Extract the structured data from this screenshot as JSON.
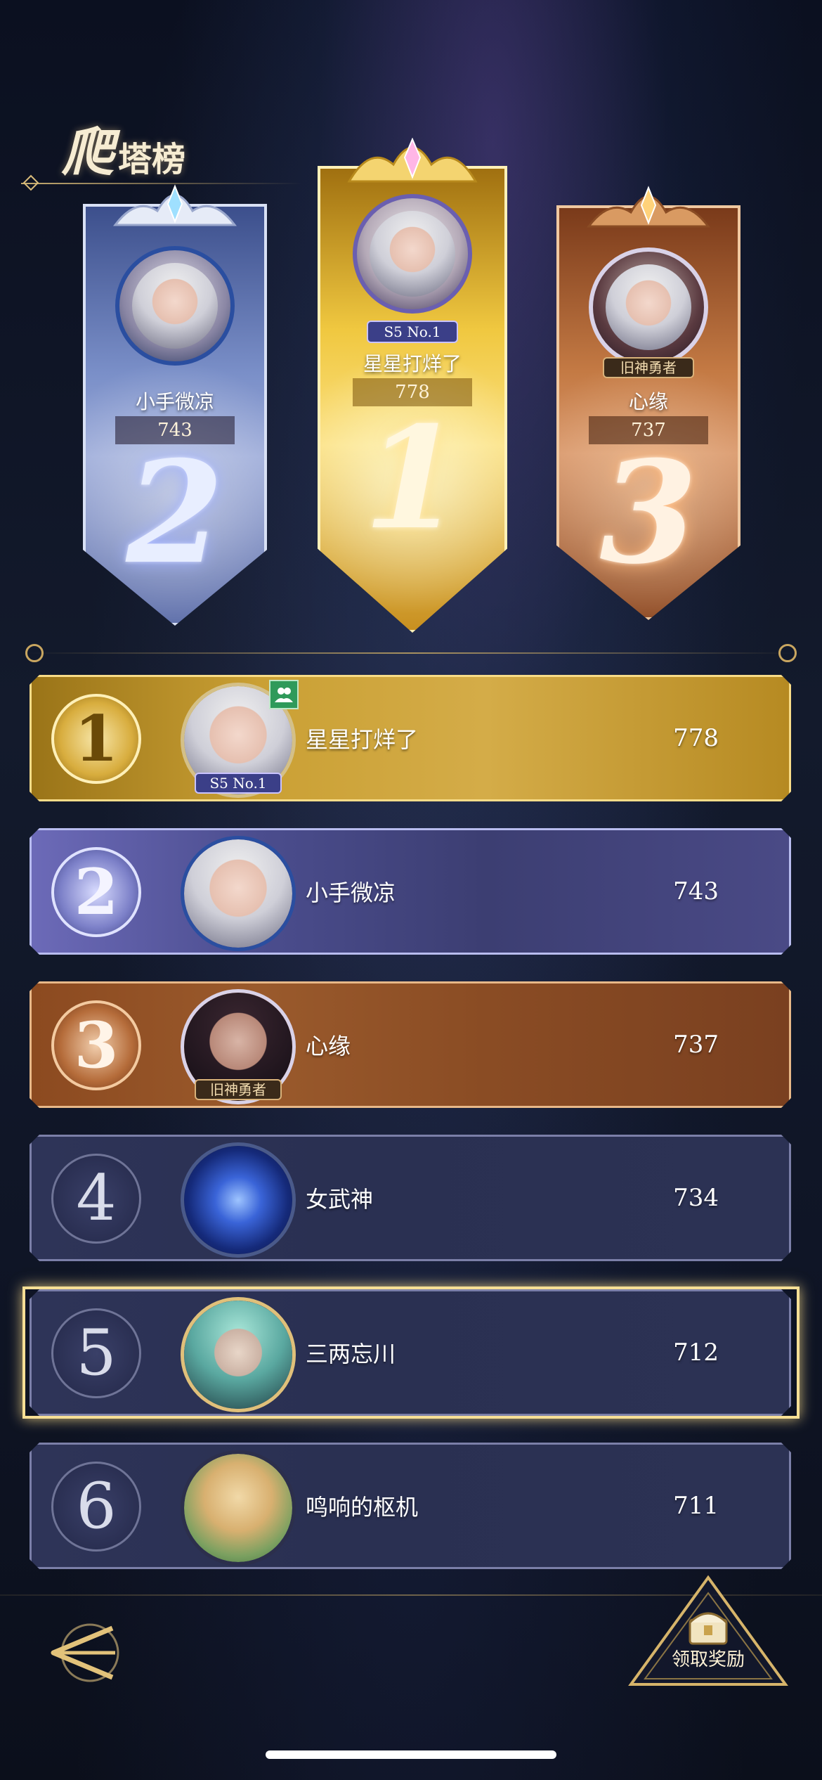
{
  "title": {
    "big": "爬",
    "small": "塔榜"
  },
  "podium": [
    {
      "rank": "2",
      "name": "小手微凉",
      "score": "743",
      "tag": ""
    },
    {
      "rank": "1",
      "name": "星星打烊了",
      "score": "778",
      "tag": "S5 No.1"
    },
    {
      "rank": "3",
      "name": "心缘",
      "score": "737",
      "tag": "旧神勇者"
    }
  ],
  "rows": [
    {
      "rank": "1",
      "name": "星星打烊了",
      "score": "778",
      "tag": "S5 No.1"
    },
    {
      "rank": "2",
      "name": "小手微凉",
      "score": "743",
      "tag": ""
    },
    {
      "rank": "3",
      "name": "心缘",
      "score": "737",
      "tag": "旧神勇者"
    },
    {
      "rank": "4",
      "name": "女武神",
      "score": "734",
      "tag": ""
    },
    {
      "rank": "5",
      "name": "三两忘川",
      "score": "712",
      "tag": ""
    },
    {
      "rank": "6",
      "name": "鸣响的枢机",
      "score": "711",
      "tag": ""
    }
  ],
  "highlighted_rank": "5",
  "reward_button": {
    "label": "领取奖励"
  },
  "icons": {
    "back": "back-arrow-icon",
    "reward": "treasure-chest-icon",
    "friend": "friend-icon"
  },
  "colors": {
    "gold": "#d4ac48",
    "silver": "#7a8fc8",
    "bronze": "#c47a44",
    "row_dark": "#2e3458",
    "highlight": "#f6df95"
  }
}
